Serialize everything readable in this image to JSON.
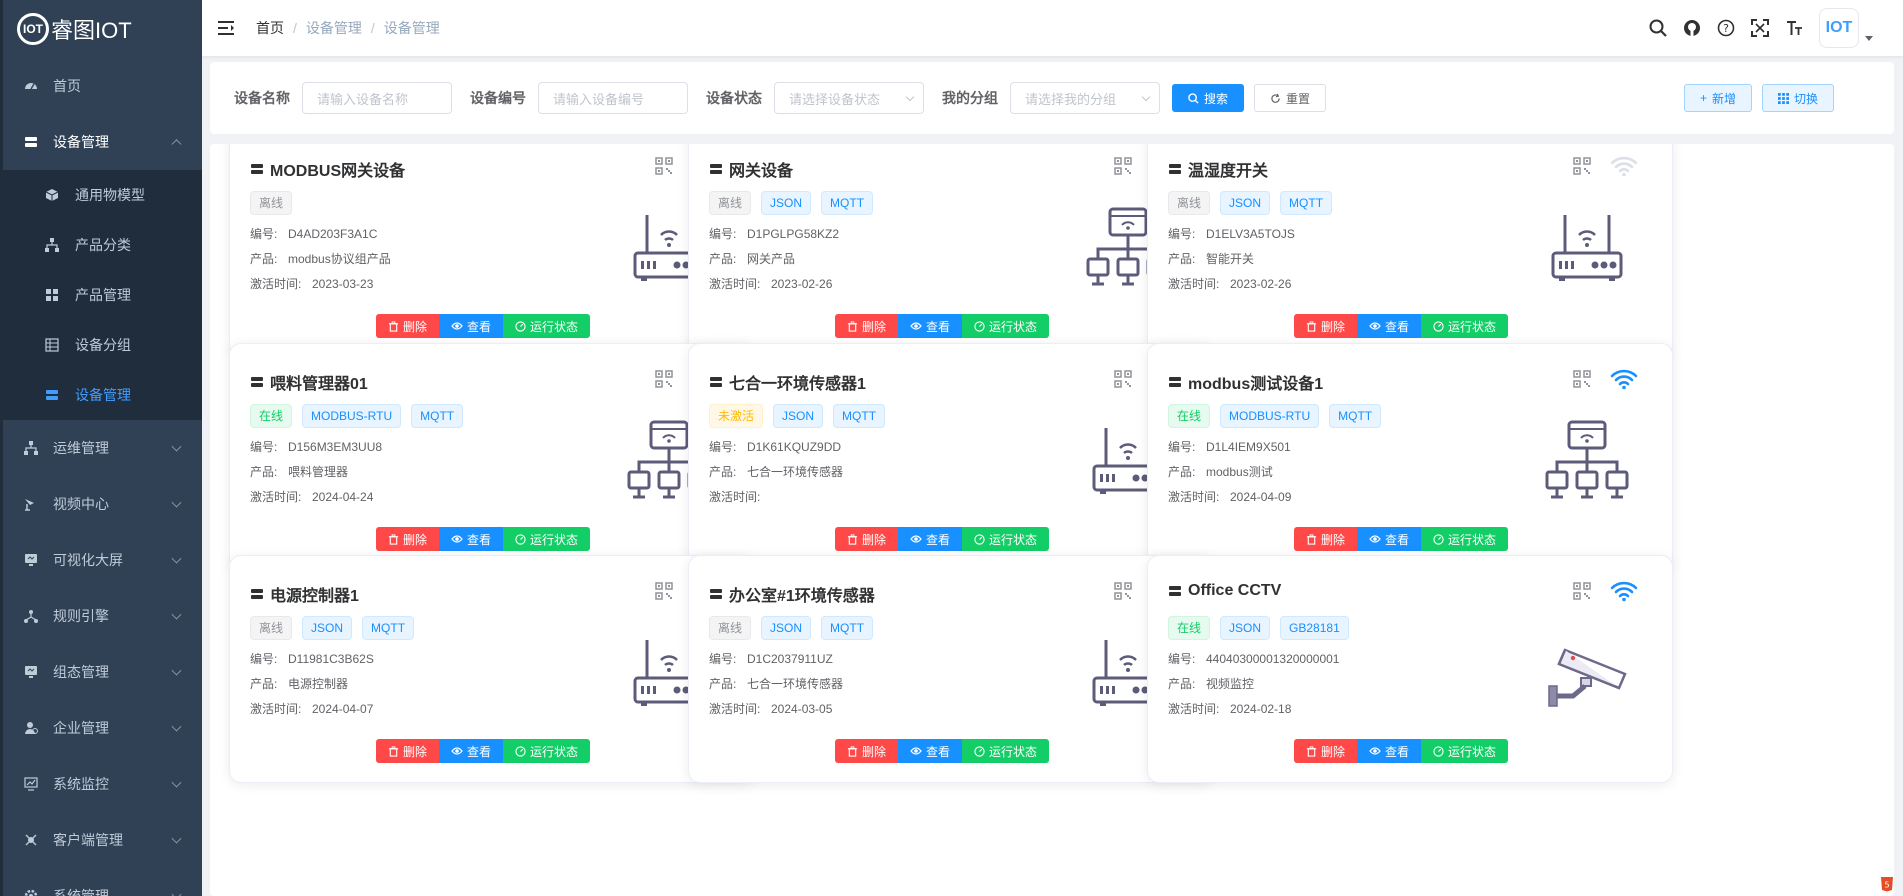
{
  "brand": {
    "logo_text": "IOT",
    "app_name": "睿图IOT"
  },
  "breadcrumb": [
    "首页",
    "设备管理",
    "设备管理"
  ],
  "header": {
    "avatar_text": "IOT"
  },
  "sidebar": {
    "items": [
      {
        "label": "首页",
        "icon": "dashboard-icon"
      },
      {
        "label": "设备管理",
        "icon": "device-icon",
        "expanded": true
      },
      {
        "label": "运维管理",
        "icon": "tree-icon"
      },
      {
        "label": "视频中心",
        "icon": "video-icon"
      },
      {
        "label": "可视化大屏",
        "icon": "monitor-icon"
      },
      {
        "label": "规则引擎",
        "icon": "rule-icon"
      },
      {
        "label": "组态管理",
        "icon": "monitor-icon"
      },
      {
        "label": "企业管理",
        "icon": "user-icon"
      },
      {
        "label": "系统监控",
        "icon": "chart-icon"
      },
      {
        "label": "客户端管理",
        "icon": "client-icon"
      },
      {
        "label": "系统管理",
        "icon": "gear-icon"
      }
    ],
    "sub_items": [
      {
        "label": "通用物模型",
        "icon": "cube-icon"
      },
      {
        "label": "产品分类",
        "icon": "tree-icon"
      },
      {
        "label": "产品管理",
        "icon": "grid-icon"
      },
      {
        "label": "设备分组",
        "icon": "list-icon"
      },
      {
        "label": "设备管理",
        "icon": "device-icon",
        "active": true
      }
    ]
  },
  "filter": {
    "name_label": "设备名称",
    "name_placeholder": "请输入设备名称",
    "serial_label": "设备编号",
    "serial_placeholder": "请输入设备编号",
    "status_label": "设备状态",
    "status_placeholder": "请选择设备状态",
    "group_label": "我的分组",
    "group_placeholder": "请选择我的分组",
    "search": "搜索",
    "reset": "重置",
    "add": "新增",
    "switch": "切换"
  },
  "labels": {
    "serial": "编号:",
    "product": "产品:",
    "activated": "激活时间:",
    "delete": "删除",
    "view": "查看",
    "run_status": "运行状态"
  },
  "colors": {
    "primary": "#1890ff",
    "danger": "#ff4949",
    "success": "#13ce66",
    "sidebar": "#304156"
  },
  "devices": [
    {
      "name": "MODBUS网关设备",
      "tags": [
        {
          "text": "离线",
          "type": "offline"
        }
      ],
      "serial": "D4AD203F3A1C",
      "product": "modbus协议组产品",
      "activated": "2023-03-23",
      "wifi": false,
      "image": "router"
    },
    {
      "name": "网关设备",
      "tags": [
        {
          "text": "离线",
          "type": "offline"
        },
        {
          "text": "JSON",
          "type": "proto"
        },
        {
          "text": "MQTT",
          "type": "proto"
        }
      ],
      "serial": "D1PGLPG58KZ2",
      "product": "网关产品",
      "activated": "2023-02-26",
      "wifi": false,
      "image": "gateway"
    },
    {
      "name": "温湿度开关",
      "tags": [
        {
          "text": "离线",
          "type": "offline"
        },
        {
          "text": "JSON",
          "type": "proto"
        },
        {
          "text": "MQTT",
          "type": "proto"
        }
      ],
      "serial": "D1ELV3A5TOJS",
      "product": "智能开关",
      "activated": "2023-02-26",
      "wifi": false,
      "image": "router"
    },
    {
      "name": "喂料管理器01",
      "tags": [
        {
          "text": "在线",
          "type": "online"
        },
        {
          "text": "MODBUS-RTU",
          "type": "proto"
        },
        {
          "text": "MQTT",
          "type": "proto"
        }
      ],
      "serial": "D156M3EM3UU8",
      "product": "喂料管理器",
      "activated": "2024-04-24",
      "wifi": true,
      "image": "gateway"
    },
    {
      "name": "七合一环境传感器1",
      "tags": [
        {
          "text": "未激活",
          "type": "inactive"
        },
        {
          "text": "JSON",
          "type": "proto"
        },
        {
          "text": "MQTT",
          "type": "proto"
        }
      ],
      "serial": "D1K61KQUZ9DD",
      "product": "七合一环境传感器",
      "activated": "",
      "wifi": false,
      "image": "router"
    },
    {
      "name": "modbus测试设备1",
      "tags": [
        {
          "text": "在线",
          "type": "online"
        },
        {
          "text": "MODBUS-RTU",
          "type": "proto"
        },
        {
          "text": "MQTT",
          "type": "proto"
        }
      ],
      "serial": "D1L4IEM9X501",
      "product": "modbus测试",
      "activated": "2024-04-09",
      "wifi": true,
      "image": "gateway"
    },
    {
      "name": "电源控制器1",
      "tags": [
        {
          "text": "离线",
          "type": "offline"
        },
        {
          "text": "JSON",
          "type": "proto"
        },
        {
          "text": "MQTT",
          "type": "proto"
        }
      ],
      "serial": "D11981C3B62S",
      "product": "电源控制器",
      "activated": "2024-04-07",
      "wifi": false,
      "image": "router"
    },
    {
      "name": "办公室#1环境传感器",
      "tags": [
        {
          "text": "离线",
          "type": "offline"
        },
        {
          "text": "JSON",
          "type": "proto"
        },
        {
          "text": "MQTT",
          "type": "proto"
        }
      ],
      "serial": "D1C2037911UZ",
      "product": "七合一环境传感器",
      "activated": "2024-03-05",
      "wifi": false,
      "image": "router"
    },
    {
      "name": "Office CCTV",
      "tags": [
        {
          "text": "在线",
          "type": "online"
        },
        {
          "text": "JSON",
          "type": "proto"
        },
        {
          "text": "GB28181",
          "type": "proto"
        }
      ],
      "serial": "44040300001320000001",
      "product": "视频监控",
      "activated": "2024-02-18",
      "wifi": true,
      "image": "camera"
    }
  ]
}
